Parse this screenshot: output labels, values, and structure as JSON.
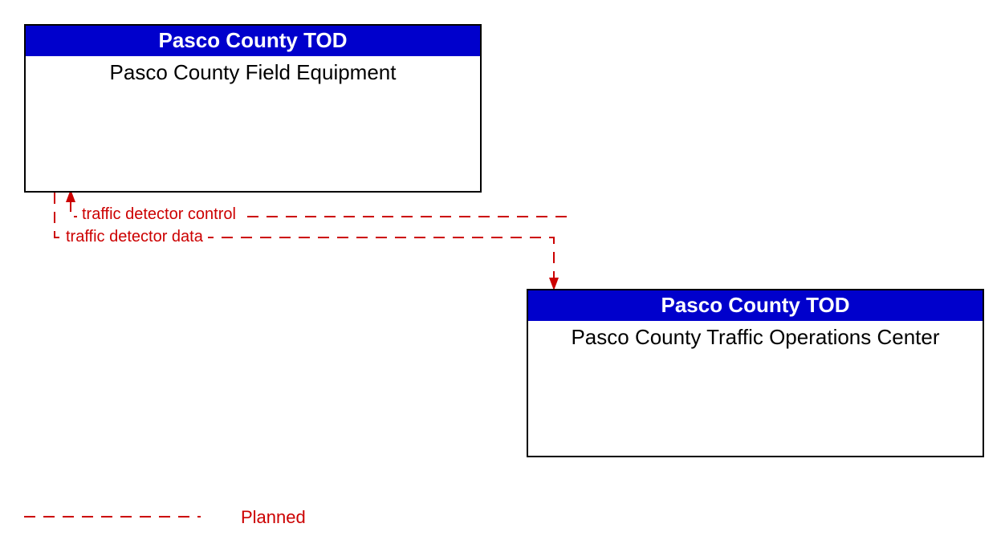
{
  "nodes": {
    "top": {
      "header": "Pasco County TOD",
      "body": "Pasco County Field Equipment"
    },
    "bottom": {
      "header": "Pasco County TOD",
      "body": "Pasco County Traffic Operations Center"
    }
  },
  "flows": {
    "control": "traffic detector control",
    "data": "traffic detector data"
  },
  "legend": {
    "planned": "Planned"
  },
  "colors": {
    "header_bg": "#0000cc",
    "planned_line": "#cc0000"
  }
}
